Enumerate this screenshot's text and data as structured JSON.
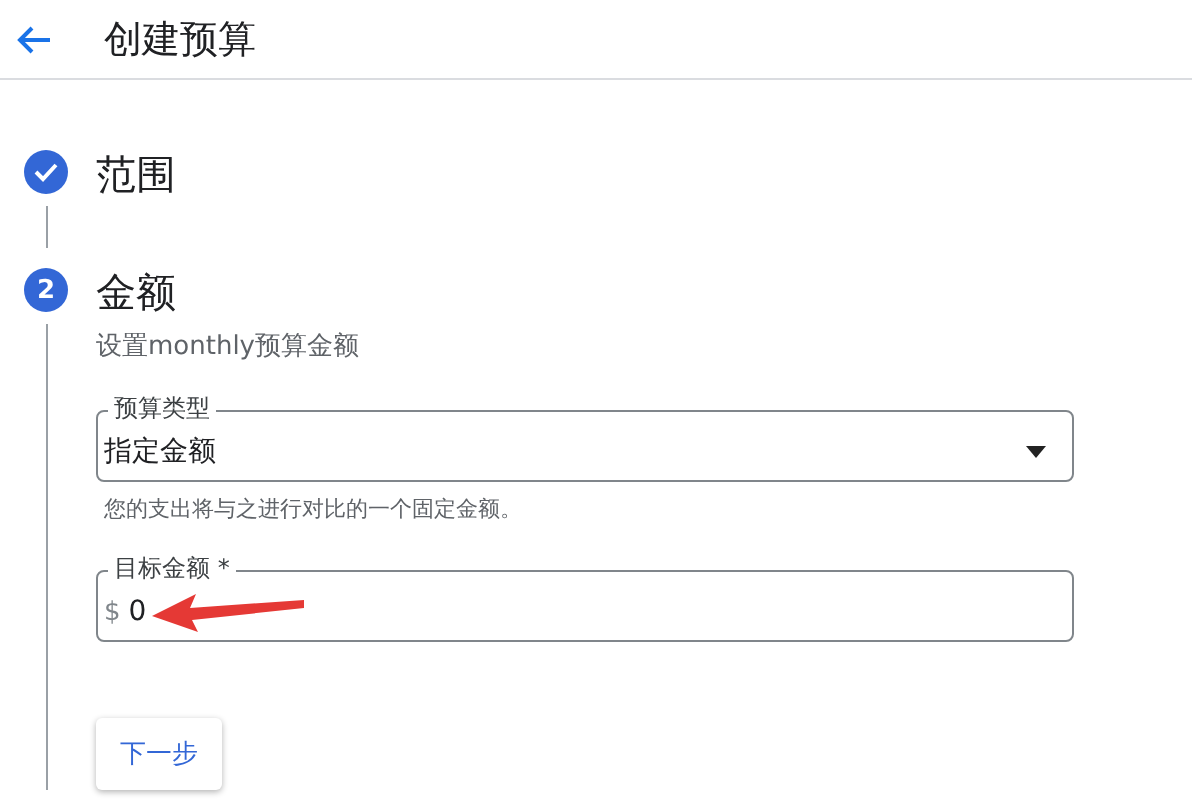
{
  "header": {
    "title": "创建预算"
  },
  "steps": [
    {
      "title": "范围",
      "done": true
    },
    {
      "number": "2",
      "title": "金额",
      "done": false,
      "subtitle": "设置monthly预算金额",
      "fields": [
        {
          "kind": "select",
          "label": "预算类型",
          "value": "指定金额",
          "hint": "您的支出将与之进行对比的一个固定金额。"
        },
        {
          "kind": "amount",
          "label": "目标金额 *",
          "prefix": "$",
          "value": "0"
        }
      ],
      "button": "下一步"
    }
  ]
}
